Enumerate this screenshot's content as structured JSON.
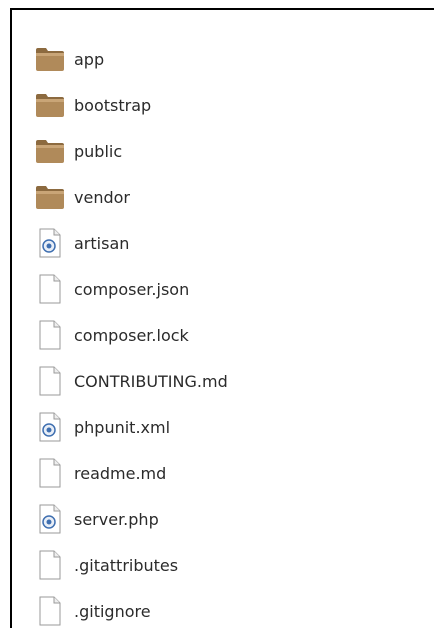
{
  "file_manager": {
    "items": [
      {
        "name": "app",
        "type": "folder",
        "icon": "folder-icon"
      },
      {
        "name": "bootstrap",
        "type": "folder",
        "icon": "folder-icon"
      },
      {
        "name": "public",
        "type": "folder",
        "icon": "folder-icon"
      },
      {
        "name": "vendor",
        "type": "folder",
        "icon": "folder-icon"
      },
      {
        "name": "artisan",
        "type": "script",
        "icon": "script-file-icon"
      },
      {
        "name": "composer.json",
        "type": "text",
        "icon": "text-file-icon"
      },
      {
        "name": "composer.lock",
        "type": "text",
        "icon": "text-file-icon"
      },
      {
        "name": "CONTRIBUTING.md",
        "type": "text",
        "icon": "text-file-icon"
      },
      {
        "name": "phpunit.xml",
        "type": "script",
        "icon": "script-file-icon"
      },
      {
        "name": "readme.md",
        "type": "text",
        "icon": "text-file-icon"
      },
      {
        "name": "server.php",
        "type": "script",
        "icon": "script-file-icon"
      },
      {
        "name": ".gitattributes",
        "type": "text",
        "icon": "text-file-icon"
      },
      {
        "name": ".gitignore",
        "type": "text",
        "icon": "text-file-icon"
      }
    ],
    "colors": {
      "folder_body": "#b08a5a",
      "folder_tab": "#8c6a3f",
      "file_page": "#ffffff",
      "file_border": "#9a9a9a",
      "script_badge": "#3f6fb0"
    }
  }
}
